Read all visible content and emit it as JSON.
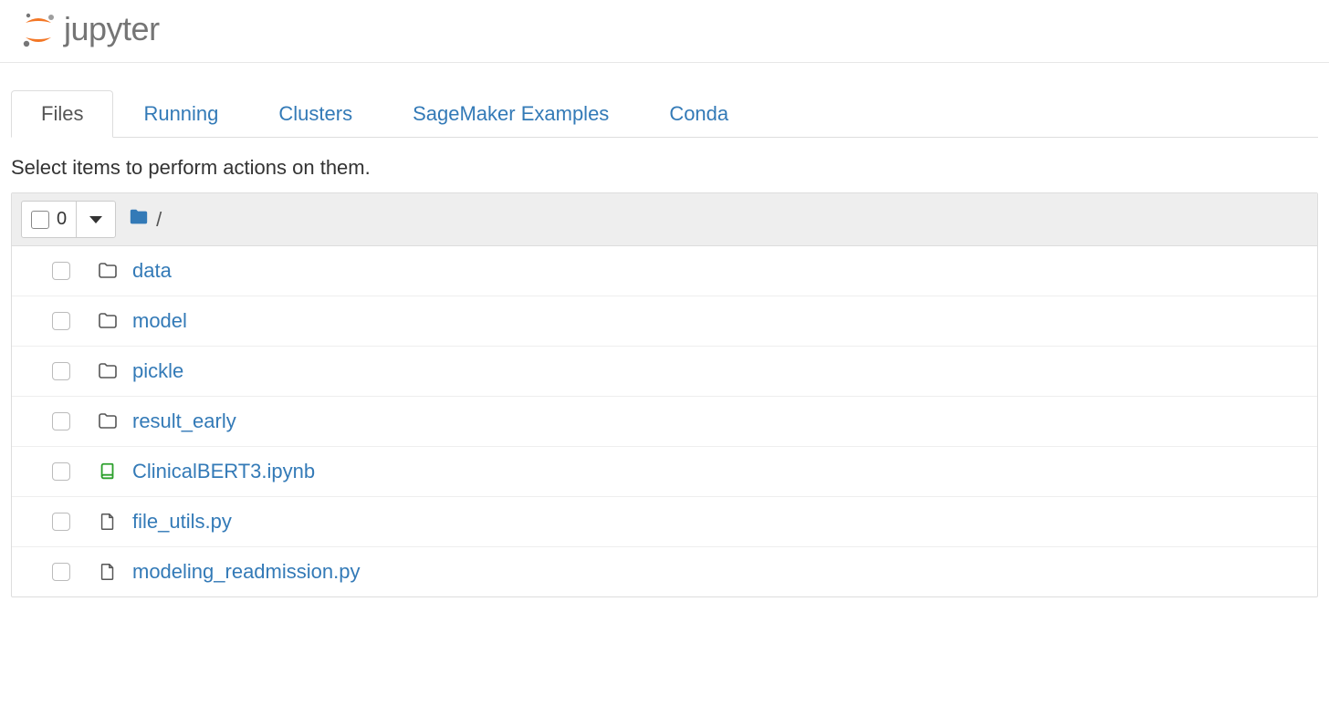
{
  "logo_text": "jupyter",
  "tabs": [
    {
      "label": "Files",
      "active": true
    },
    {
      "label": "Running",
      "active": false
    },
    {
      "label": "Clusters",
      "active": false
    },
    {
      "label": "SageMaker Examples",
      "active": false
    },
    {
      "label": "Conda",
      "active": false
    }
  ],
  "toolbar_hint": "Select items to perform actions on them.",
  "select_count": "0",
  "breadcrumb": {
    "icon": "folder-solid-icon",
    "path": "/"
  },
  "items": [
    {
      "name": "data",
      "icon": "folder",
      "link_color": "#337ab7"
    },
    {
      "name": "model",
      "icon": "folder",
      "link_color": "#337ab7"
    },
    {
      "name": "pickle",
      "icon": "folder",
      "link_color": "#337ab7"
    },
    {
      "name": "result_early",
      "icon": "folder",
      "link_color": "#337ab7"
    },
    {
      "name": "ClinicalBERT3.ipynb",
      "icon": "notebook",
      "link_color": "#337ab7"
    },
    {
      "name": "file_utils.py",
      "icon": "file",
      "link_color": "#337ab7"
    },
    {
      "name": "modeling_readmission.py",
      "icon": "file",
      "link_color": "#337ab7"
    }
  ]
}
